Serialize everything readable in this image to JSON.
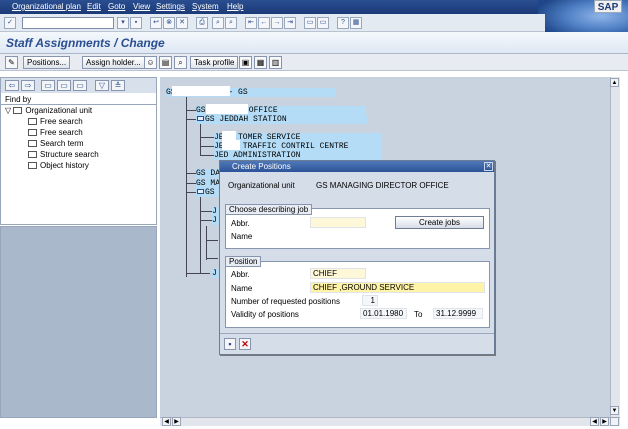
{
  "menu": [
    "Organizational plan",
    "Edit",
    "Goto",
    "View",
    "Settings",
    "System",
    "Help"
  ],
  "brand": "SAP",
  "title": "Staff Assignments / Change",
  "app_toolbar": {
    "positions": "Positions...",
    "assign_holder": "Assign holder...",
    "task_profile": "Task profile"
  },
  "left_pane": {
    "find_by": "Find by",
    "root": "Organizational unit",
    "items": [
      "Free search",
      "Free search",
      "Search term",
      "Structure search",
      "Object history"
    ]
  },
  "tree": [
    "GS ... LINES - GS",
    "GS ...CTOR OFFICE",
    "GS JEDDAH STATION",
    "JE...TOMER SERVICE",
    "JE... TRAFFIC CONTRIL CENTRE",
    "JED ADMINISTRATION",
    "GS DA",
    "GS MA",
    "GS OP",
    "J",
    "J",
    "J"
  ],
  "dialog": {
    "title": "Create Positions",
    "org_unit_label": "Organizational unit",
    "org_unit_value": "GS MANAGING DIRECTOR OFFICE",
    "job_group": {
      "title": "Choose describing job",
      "abbr_label": "Abbr.",
      "abbr_value": "",
      "name_label": "Name",
      "create_jobs": "Create jobs"
    },
    "position_group": {
      "title": "Position",
      "abbr_label": "Abbr.",
      "abbr_value": "CHIEF",
      "name_label": "Name",
      "name_value": "CHIEF ,GROUND SERVICE",
      "count_label": "Number of requested positions",
      "count_value": "1",
      "validity_label": "Validity of positions",
      "valid_from": "01.01.1980",
      "to_label": "To",
      "valid_to": "31.12.9999"
    }
  },
  "colors": {
    "menubar": "#1b3a78",
    "title": "#2a4e90",
    "tree_highlight": "#b4dcf6",
    "required_field": "#fff8d8",
    "cancel": "#c00000"
  }
}
